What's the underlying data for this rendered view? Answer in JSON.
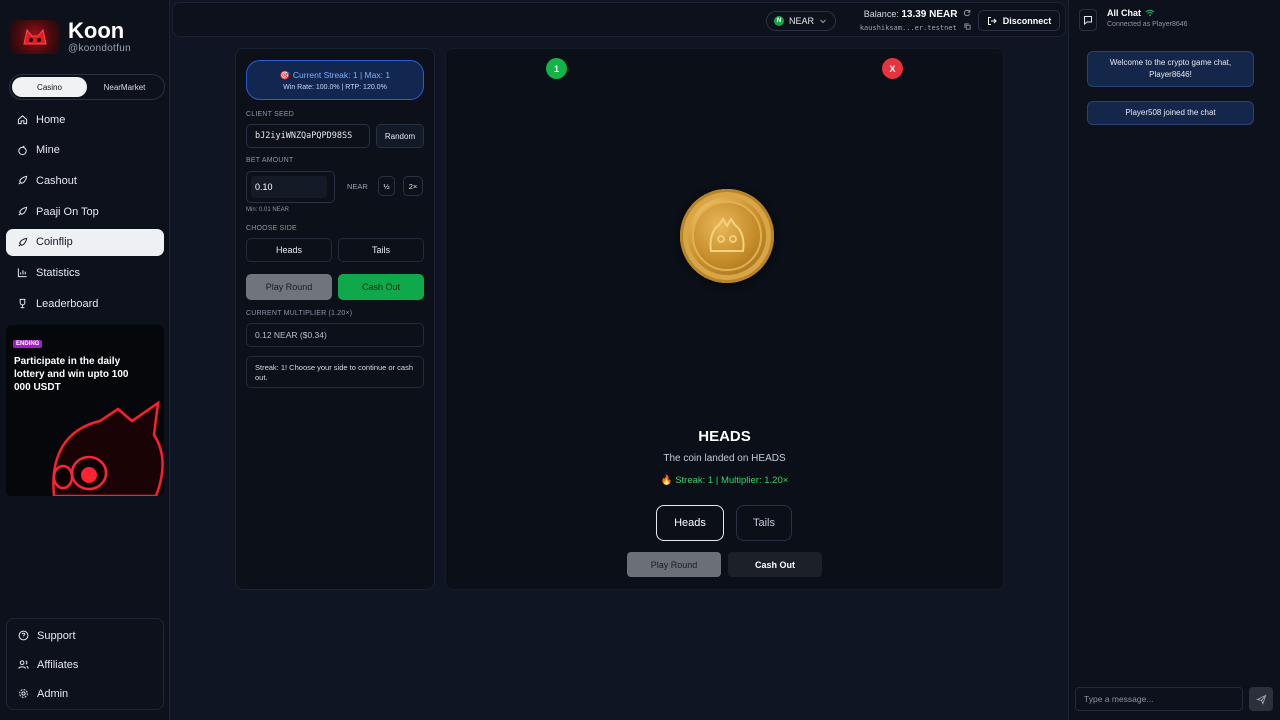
{
  "brand": {
    "name": "Koon",
    "handle": "@koondotfun"
  },
  "mode_toggle": {
    "options": [
      "Casino",
      "NearMarket"
    ],
    "active": "Casino"
  },
  "nav": {
    "items": [
      {
        "label": "Home",
        "icon": "home-icon"
      },
      {
        "label": "Mine",
        "icon": "mine-icon"
      },
      {
        "label": "Cashout",
        "icon": "rocket-icon"
      },
      {
        "label": "Paaji On Top",
        "icon": "rocket-icon"
      },
      {
        "label": "Coinflip",
        "icon": "rocket-icon",
        "active": true
      },
      {
        "label": "Statistics",
        "icon": "bar-chart-icon"
      },
      {
        "label": "Leaderboard",
        "icon": "trophy-icon"
      }
    ]
  },
  "promo": {
    "badge": "ENDING",
    "text": "Participate in the daily lottery and win upto 100 000 USDT"
  },
  "bottom_nav": {
    "items": [
      {
        "label": "Support",
        "icon": "help-circle-icon"
      },
      {
        "label": "Affiliates",
        "icon": "users-icon"
      },
      {
        "label": "Admin",
        "icon": "gear-icon"
      }
    ]
  },
  "topbar": {
    "network": "NEAR",
    "balance_label": "Balance:",
    "balance_value": "13.39 NEAR",
    "account": "kaushiksam...er.testnet",
    "disconnect_label": "Disconnect"
  },
  "panel": {
    "streak_line1": "Current Streak: 1 | Max: 1",
    "streak_line2": "Win Rate: 100.0% | RTP: 120.0%",
    "client_seed_label": "CLIENT SEED",
    "client_seed_value": "bJ2iyiWNZQaPQPD98SS",
    "random_label": "Random",
    "bet_amount_label": "BET AMOUNT",
    "bet_amount_value": "0.10",
    "bet_unit": "NEAR",
    "half_label": "½",
    "double_label": "2×",
    "min_note": "Min: 0.01 NEAR",
    "choose_side_label": "CHOOSE SIDE",
    "heads_label": "Heads",
    "tails_label": "Tails",
    "play_label": "Play Round",
    "cashout_label": "Cash Out",
    "multiplier_label": "CURRENT MULTIPLIER (1.20×)",
    "multiplier_value": "0.12 NEAR ($0.34)",
    "status_text": "Streak: 1! Choose your side to continue or cash out."
  },
  "game": {
    "history": [
      {
        "label": "1",
        "result": "win",
        "color": "#12b347"
      },
      {
        "label": "X",
        "result": "loss",
        "color": "#e5343d"
      }
    ],
    "result_title": "HEADS",
    "result_subtitle": "The coin landed on HEADS",
    "streak_text": "Streak: 1 | Multiplier: 1.20×",
    "heads_label": "Heads",
    "tails_label": "Tails",
    "play_label": "Play Round",
    "cashout_label": "Cash Out"
  },
  "chat": {
    "title": "All Chat",
    "subtitle": "Connected as Player8646",
    "messages": [
      "Welcome to the crypto game chat, Player8646!",
      "Player508 joined the chat"
    ],
    "input_placeholder": "Type a message..."
  },
  "colors": {
    "accent_green": "#0fa84a",
    "loss_red": "#e5343d",
    "streak_blue": "#7fb0ff",
    "background": "#0f1522"
  }
}
